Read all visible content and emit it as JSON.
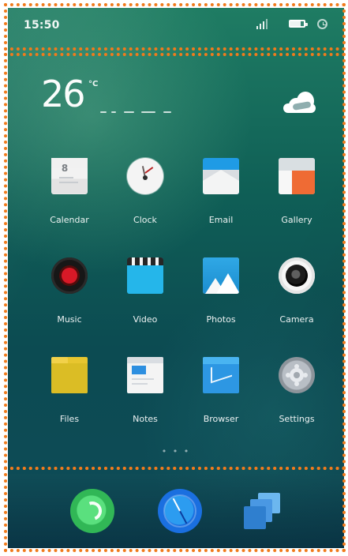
{
  "status_bar": {
    "time": "15:50"
  },
  "weather": {
    "temperature": "26",
    "unit": "°C",
    "icon": "cloud-icon"
  },
  "apps": [
    {
      "label": "Calendar",
      "icon": "calendar-icon"
    },
    {
      "label": "Clock",
      "icon": "clock-icon"
    },
    {
      "label": "Email",
      "icon": "mail-icon"
    },
    {
      "label": "Gallery",
      "icon": "gallery-icon"
    },
    {
      "label": "Music",
      "icon": "music-icon"
    },
    {
      "label": "Video",
      "icon": "video-icon"
    },
    {
      "label": "Photos",
      "icon": "photos-icon"
    },
    {
      "label": "Camera",
      "icon": "camera-icon"
    },
    {
      "label": "Files",
      "icon": "folder-icon"
    },
    {
      "label": "Notes",
      "icon": "notes-icon"
    },
    {
      "label": "Browser",
      "icon": "browser-icon"
    },
    {
      "label": "Settings",
      "icon": "settings-icon"
    }
  ],
  "page_indicator": "• • •",
  "dock": [
    {
      "label": "",
      "icon": "phone-icon"
    },
    {
      "label": "",
      "icon": "compass-icon"
    },
    {
      "label": "",
      "icon": "windows-icon"
    }
  ],
  "colors": {
    "screen_top": "#1f7c63",
    "screen_bottom": "#0e4b58",
    "highlight": "#f07b1c"
  }
}
